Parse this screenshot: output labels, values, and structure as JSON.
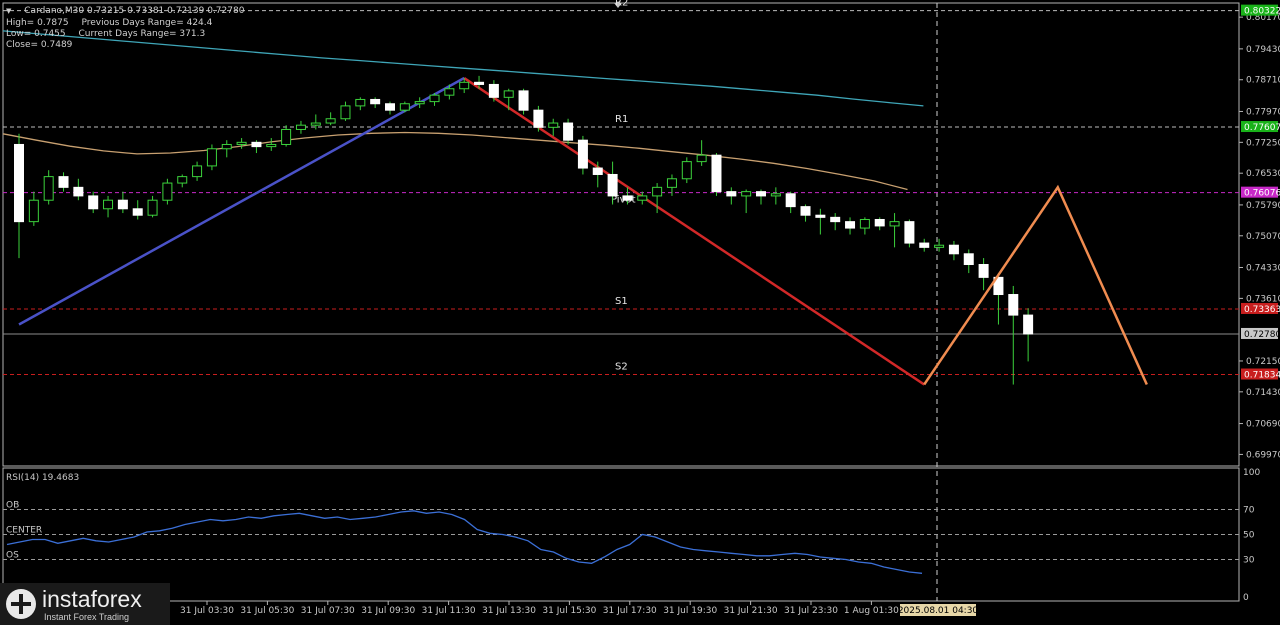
{
  "header": {
    "line1": "Cardano,M30  0.73215 0.73381 0.72139 0.72780",
    "high": "High= 0.7875",
    "prev_range": "Previous Days Range= 424.4",
    "low": "Low= 0.7455",
    "cur_range": "Current Days Range= 371.3",
    "close": "Close= 0.7489"
  },
  "chart_data": {
    "type": "candlestick",
    "symbol": "Cardano",
    "timeframe": "M30",
    "ylim": [
      0.697,
      0.805
    ],
    "price_ticks": [
      "0.80170",
      "0.79430",
      "0.78710",
      "0.77970",
      "0.77250",
      "0.76530",
      "0.75790",
      "0.75070",
      "0.74330",
      "0.73610",
      "0.72150",
      "0.71430",
      "0.70690",
      "0.69970"
    ],
    "time_ticks": [
      "31 Jul 03:30",
      "31 Jul 05:30",
      "31 Jul 07:30",
      "31 Jul 09:30",
      "31 Jul 11:30",
      "31 Jul 13:30",
      "31 Jul 15:30",
      "31 Jul 17:30",
      "31 Jul 19:30",
      "31 Jul 21:30",
      "31 Jul 23:30",
      "1 Aug 01:30"
    ],
    "current_time_label": "2025.08.01 04:30",
    "price_tags": [
      {
        "label": "0.80322",
        "value": 0.80322,
        "color": "#19b219"
      },
      {
        "label": "0.77607",
        "value": 0.77607,
        "color": "#19b219"
      },
      {
        "label": "0.76076",
        "value": 0.76076,
        "color": "#c828c8"
      },
      {
        "label": "0.73363",
        "value": 0.73363,
        "color": "#c81e1e"
      },
      {
        "label": "0.72780",
        "value": 0.7278,
        "color": "#c8c8c8"
      },
      {
        "label": "0.71834",
        "value": 0.71834,
        "color": "#c81e1e"
      }
    ],
    "levels": [
      {
        "name": "R2",
        "value": 0.80322,
        "color": "#bcbcbc"
      },
      {
        "name": "R1",
        "value": 0.77607,
        "color": "#bcbcbc"
      },
      {
        "name": "Pivot",
        "value": 0.76076,
        "color": "#c828c8"
      },
      {
        "name": "S1",
        "value": 0.73363,
        "color": "#c81e1e"
      },
      {
        "name": "S2",
        "value": 0.71834,
        "color": "#c81e1e"
      }
    ],
    "candles": [
      [
        0.772,
        0.7745,
        0.7455,
        0.754
      ],
      [
        0.754,
        0.761,
        0.753,
        0.759
      ],
      [
        0.759,
        0.766,
        0.758,
        0.7645
      ],
      [
        0.7645,
        0.7655,
        0.761,
        0.762
      ],
      [
        0.762,
        0.764,
        0.759,
        0.76
      ],
      [
        0.76,
        0.761,
        0.756,
        0.757
      ],
      [
        0.757,
        0.76,
        0.755,
        0.759
      ],
      [
        0.759,
        0.761,
        0.756,
        0.757
      ],
      [
        0.757,
        0.759,
        0.7545,
        0.7555
      ],
      [
        0.7555,
        0.76,
        0.755,
        0.759
      ],
      [
        0.759,
        0.764,
        0.758,
        0.763
      ],
      [
        0.763,
        0.765,
        0.762,
        0.7645
      ],
      [
        0.7645,
        0.768,
        0.7635,
        0.767
      ],
      [
        0.767,
        0.772,
        0.766,
        0.771
      ],
      [
        0.771,
        0.773,
        0.769,
        0.772
      ],
      [
        0.772,
        0.7735,
        0.771,
        0.7725
      ],
      [
        0.7725,
        0.773,
        0.77,
        0.7715
      ],
      [
        0.7715,
        0.7735,
        0.7705,
        0.772
      ],
      [
        0.772,
        0.7765,
        0.7715,
        0.7755
      ],
      [
        0.7755,
        0.7775,
        0.7745,
        0.7765
      ],
      [
        0.7765,
        0.779,
        0.7755,
        0.777
      ],
      [
        0.777,
        0.7795,
        0.7765,
        0.778
      ],
      [
        0.778,
        0.782,
        0.7775,
        0.781
      ],
      [
        0.781,
        0.783,
        0.78,
        0.7825
      ],
      [
        0.7825,
        0.783,
        0.7805,
        0.7815
      ],
      [
        0.7815,
        0.782,
        0.779,
        0.78
      ],
      [
        0.78,
        0.782,
        0.7795,
        0.7815
      ],
      [
        0.7815,
        0.783,
        0.7805,
        0.782
      ],
      [
        0.782,
        0.784,
        0.781,
        0.7835
      ],
      [
        0.7835,
        0.786,
        0.7825,
        0.785
      ],
      [
        0.785,
        0.7875,
        0.784,
        0.7865
      ],
      [
        0.7865,
        0.788,
        0.785,
        0.786
      ],
      [
        0.786,
        0.787,
        0.782,
        0.783
      ],
      [
        0.783,
        0.785,
        0.78,
        0.7845
      ],
      [
        0.7845,
        0.785,
        0.779,
        0.78
      ],
      [
        0.78,
        0.781,
        0.775,
        0.776
      ],
      [
        0.776,
        0.778,
        0.774,
        0.777
      ],
      [
        0.777,
        0.778,
        0.772,
        0.773
      ],
      [
        0.773,
        0.774,
        0.765,
        0.7665
      ],
      [
        0.7665,
        0.768,
        0.762,
        0.765
      ],
      [
        0.765,
        0.768,
        0.758,
        0.76
      ],
      [
        0.76,
        0.762,
        0.758,
        0.759
      ],
      [
        0.759,
        0.761,
        0.758,
        0.76
      ],
      [
        0.76,
        0.763,
        0.756,
        0.762
      ],
      [
        0.762,
        0.765,
        0.76,
        0.764
      ],
      [
        0.764,
        0.769,
        0.763,
        0.768
      ],
      [
        0.768,
        0.773,
        0.767,
        0.7695
      ],
      [
        0.7695,
        0.77,
        0.76,
        0.761
      ],
      [
        0.761,
        0.762,
        0.758,
        0.76
      ],
      [
        0.76,
        0.7615,
        0.756,
        0.761
      ],
      [
        0.761,
        0.7615,
        0.758,
        0.76
      ],
      [
        0.76,
        0.762,
        0.758,
        0.7605
      ],
      [
        0.7605,
        0.761,
        0.756,
        0.7575
      ],
      [
        0.7575,
        0.758,
        0.754,
        0.7555
      ],
      [
        0.7555,
        0.757,
        0.751,
        0.755
      ],
      [
        0.755,
        0.756,
        0.752,
        0.754
      ],
      [
        0.754,
        0.755,
        0.751,
        0.7525
      ],
      [
        0.7525,
        0.755,
        0.751,
        0.7545
      ],
      [
        0.7545,
        0.755,
        0.752,
        0.753
      ],
      [
        0.753,
        0.756,
        0.748,
        0.754
      ],
      [
        0.754,
        0.7545,
        0.748,
        0.749
      ],
      [
        0.749,
        0.75,
        0.747,
        0.748
      ],
      [
        0.748,
        0.75,
        0.747,
        0.7485
      ],
      [
        0.7485,
        0.7495,
        0.745,
        0.7465
      ],
      [
        0.7465,
        0.7475,
        0.742,
        0.744
      ],
      [
        0.744,
        0.7455,
        0.738,
        0.741
      ],
      [
        0.741,
        0.742,
        0.73,
        0.737
      ],
      [
        0.737,
        0.739,
        0.716,
        0.7322
      ],
      [
        0.7322,
        0.7338,
        0.7214,
        0.7278
      ]
    ],
    "ma_long": [
      0.7985,
      0.7978,
      0.7971,
      0.7964,
      0.7957,
      0.795,
      0.7943,
      0.7936,
      0.7929,
      0.7922,
      0.7916,
      0.791,
      0.7904,
      0.7898,
      0.7892,
      0.7886,
      0.788,
      0.7874,
      0.7868,
      0.7862,
      0.7856,
      0.7849,
      0.7842,
      0.7835,
      0.7826,
      0.7818,
      0.781
    ],
    "ma_short": [
      0.7745,
      0.773,
      0.7716,
      0.7705,
      0.7698,
      0.77,
      0.7706,
      0.7715,
      0.7726,
      0.7735,
      0.7742,
      0.7746,
      0.7748,
      0.7746,
      0.7742,
      0.7736,
      0.773,
      0.7724,
      0.7718,
      0.7711,
      0.7703,
      0.7695,
      0.7686,
      0.7676,
      0.7664,
      0.765,
      0.7635,
      0.7615
    ],
    "zigzag": [
      [
        0,
        0.73
      ],
      [
        30,
        0.7875
      ],
      [
        61,
        0.716
      ]
    ],
    "forecast": [
      [
        61,
        0.716
      ],
      [
        70,
        0.762
      ],
      [
        76,
        0.716
      ]
    ],
    "rsi": {
      "label": "RSI(14) 19.4683",
      "ylim": [
        0,
        100
      ],
      "ticks": [
        "100",
        "70",
        "50",
        "30",
        "0"
      ],
      "levels": [
        {
          "name": "OB",
          "value": 70
        },
        {
          "name": "CENTER",
          "value": 50
        },
        {
          "name": "OS",
          "value": 30
        }
      ],
      "values": [
        42,
        44,
        46,
        46,
        43,
        45,
        47,
        45,
        44,
        46,
        48,
        52,
        53,
        55,
        58,
        60,
        62,
        61,
        62,
        64,
        63,
        65,
        66,
        67,
        65,
        63,
        64,
        62,
        63,
        64,
        66,
        68,
        69,
        67,
        68,
        66,
        62,
        54,
        51,
        50,
        48,
        45,
        38,
        36,
        31,
        28,
        27,
        32,
        38,
        42,
        50,
        48,
        44,
        40,
        38,
        37,
        36,
        35,
        34,
        33,
        33,
        34,
        35,
        34,
        32,
        31,
        30,
        28,
        27,
        24,
        22,
        20,
        19
      ]
    }
  }
}
